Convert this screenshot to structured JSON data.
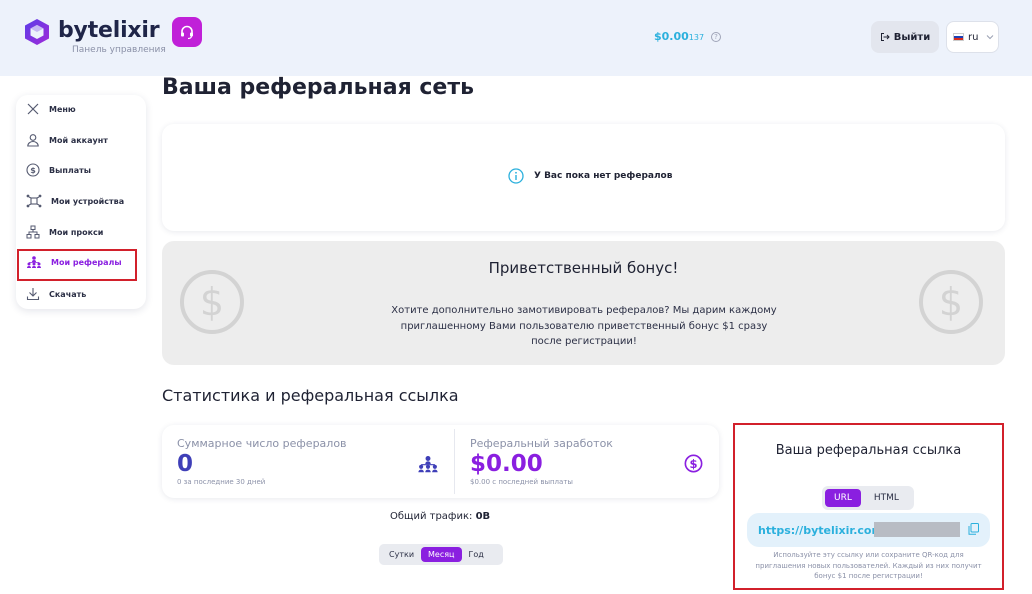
{
  "header": {
    "brand": "bytelixir",
    "subtitle": "Панель управления",
    "balance_main": "$0.00",
    "balance_small": "137",
    "logout_label": "Выйти",
    "language": "ru"
  },
  "sidebar": {
    "items": [
      {
        "label": "Меню",
        "icon": "close-icon"
      },
      {
        "label": "Мой аккаунт",
        "icon": "user-icon"
      },
      {
        "label": "Выплаты",
        "icon": "dollar-coin-icon"
      },
      {
        "label": "Мои устройства",
        "icon": "devices-icon"
      },
      {
        "label": "Мои прокси",
        "icon": "proxy-network-icon"
      },
      {
        "label": "Мои рефералы",
        "icon": "referrals-icon",
        "active": true
      },
      {
        "label": "Скачать",
        "icon": "download-icon"
      }
    ]
  },
  "main": {
    "title": "Ваша реферальная сеть",
    "empty_message": "У Вас пока нет рефералов",
    "bonus": {
      "title": "Приветственный бонус!",
      "text": "Хотите дополнительно замотивировать рефералов? Мы дарим каждому приглашенному Вами пользователю приветственный бонус $1 сразу после регистрации!"
    },
    "stats_title": "Статистика и реферальная ссылка",
    "stats": {
      "total_label": "Суммарное число рефералов",
      "total_value": "0",
      "total_sub": "0 за последние 30 дней",
      "earn_label": "Реферальный заработок",
      "earn_value": "$0.00",
      "earn_sub": "$0.00 с последней выплаты"
    },
    "traffic_label": "Общий трафик:",
    "traffic_value": "0B",
    "period_tabs": [
      "Сутки",
      "Месяц",
      "Год"
    ],
    "period_active": "Месяц"
  },
  "ref_link": {
    "title": "Ваша реферальная ссылка",
    "tabs": [
      "URL",
      "HTML"
    ],
    "active_tab": "URL",
    "url": "https://bytelixir.com/r/",
    "note": "Используйте эту ссылку или сохраните QR-код для приглашения новых пользователей. Каждый из них получит бонус $1 после регистрации!"
  },
  "colors": {
    "accent": "#8a1fe0",
    "link": "#2bb0dd",
    "highlight": "#d2202b",
    "header_bg": "#edf2fb"
  }
}
